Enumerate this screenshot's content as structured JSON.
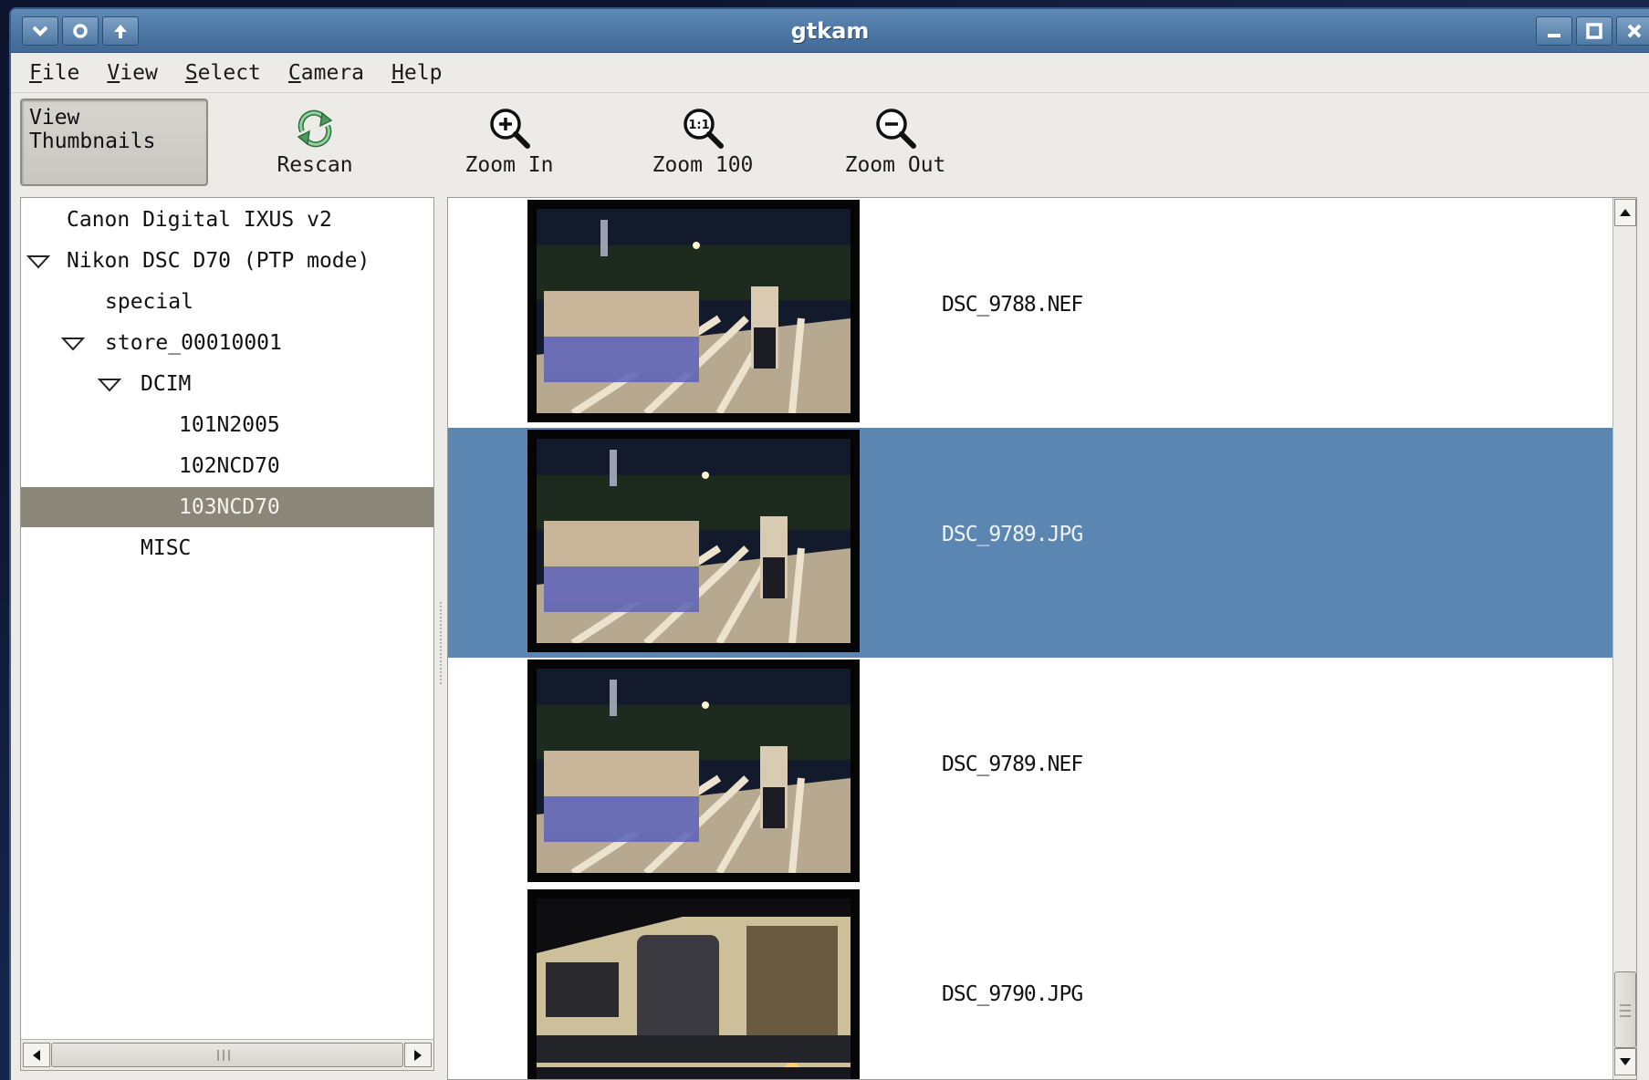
{
  "window": {
    "title": "gtkam",
    "left_controls": [
      "menu-icon",
      "shade-icon",
      "raise-icon"
    ],
    "right_controls": [
      "minimize-icon",
      "maximize-icon",
      "close-icon"
    ]
  },
  "menubar": {
    "items": [
      {
        "mnemonic": "F",
        "rest": "ile"
      },
      {
        "mnemonic": "V",
        "rest": "iew"
      },
      {
        "mnemonic": "S",
        "rest": "elect"
      },
      {
        "mnemonic": "C",
        "rest": "amera"
      },
      {
        "mnemonic": "H",
        "rest": "elp"
      }
    ]
  },
  "toolbar": {
    "view_thumbnails": "View Thumbnails",
    "rescan": "Rescan",
    "zoom_in": "Zoom In",
    "zoom_100": "Zoom 100",
    "zoom_100_icon_text": "1:1",
    "zoom_out": "Zoom Out"
  },
  "tree": {
    "items": [
      {
        "label": "Canon Digital IXUS v2",
        "expanded": null,
        "selected": false
      },
      {
        "label": "Nikon DSC D70 (PTP mode)",
        "expanded": true,
        "selected": false
      },
      {
        "label": "special",
        "expanded": null,
        "selected": false
      },
      {
        "label": "store_00010001",
        "expanded": true,
        "selected": false
      },
      {
        "label": "DCIM",
        "expanded": true,
        "selected": false
      },
      {
        "label": "101N2005",
        "expanded": null,
        "selected": false
      },
      {
        "label": "102NCD70",
        "expanded": null,
        "selected": false
      },
      {
        "label": "103NCD70",
        "expanded": null,
        "selected": true
      },
      {
        "label": "MISC",
        "expanded": null,
        "selected": false
      }
    ]
  },
  "files": {
    "items": [
      {
        "name": "DSC_9788.NEF",
        "selected": false,
        "image": "night-parade-photo"
      },
      {
        "name": "DSC_9789.JPG",
        "selected": true,
        "image": "night-parade-photo"
      },
      {
        "name": "DSC_9789.NEF",
        "selected": false,
        "image": "night-parade-photo"
      },
      {
        "name": "DSC_9790.JPG",
        "selected": false,
        "image": "bus-night-photo"
      }
    ]
  },
  "colors": {
    "titlebar": "#4a74a1",
    "selection_tree": "#8b8778",
    "selection_files": "#5c86b2",
    "window_bg": "#ecebe8"
  }
}
